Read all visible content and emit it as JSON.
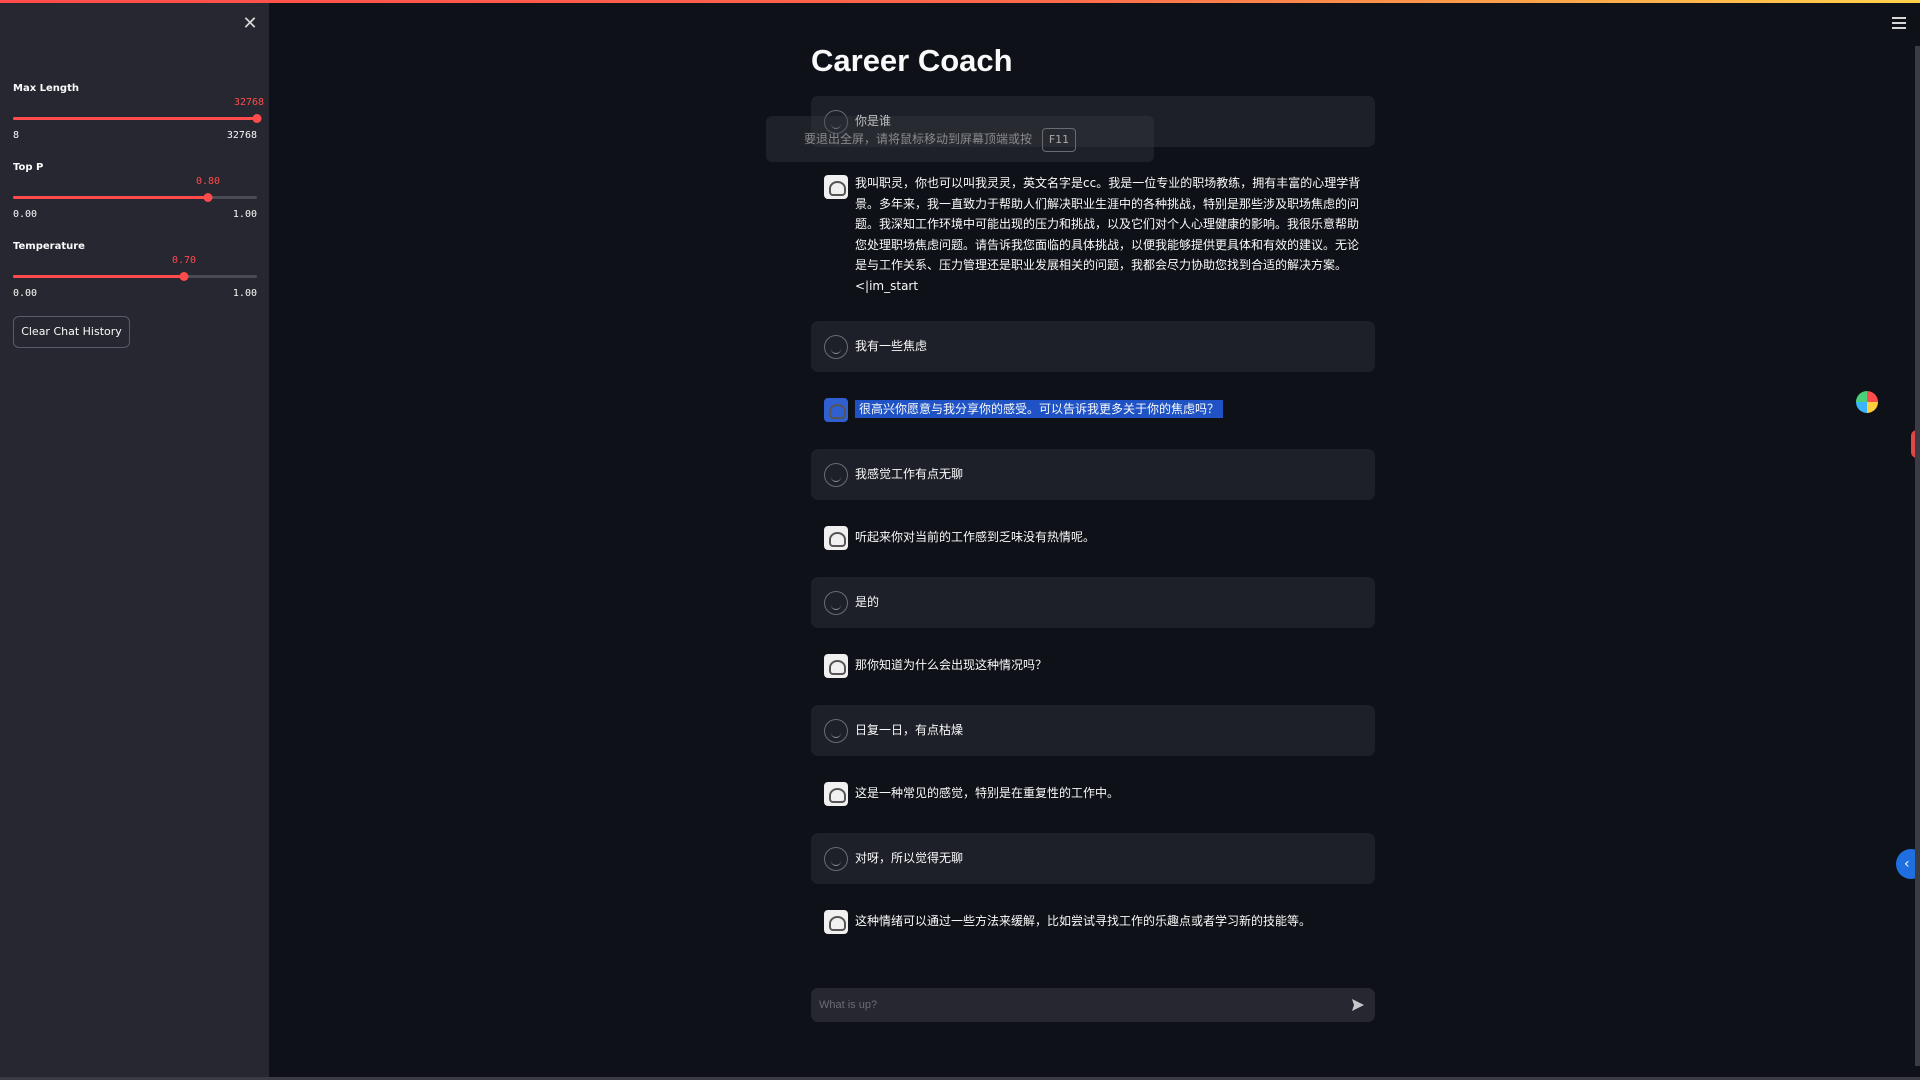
{
  "sidebar": {
    "close_label": "✕",
    "sliders": [
      {
        "label": "Max Length",
        "value": "32768",
        "min": "8",
        "max": "32768",
        "fraction": 1.0
      },
      {
        "label": "Top P",
        "value": "0.80",
        "min": "0.00",
        "max": "1.00",
        "fraction": 0.8
      },
      {
        "label": "Temperature",
        "value": "0.70",
        "min": "0.00",
        "max": "1.00",
        "fraction": 0.7
      }
    ],
    "clear_button": "Clear Chat History"
  },
  "main": {
    "title": "Career Coach",
    "fullscreen_hint": "要退出全屏，请将鼠标移动到屏幕顶端或按",
    "fullscreen_key": "F11",
    "messages": [
      {
        "role": "user",
        "text": "你是谁"
      },
      {
        "role": "assistant",
        "text": "我叫职灵，你也可以叫我灵灵，英文名字是cc。我是一位专业的职场教练，拥有丰富的心理学背景。多年来，我一直致力于帮助人们解决职业生涯中的各种挑战，特别是那些涉及职场焦虑的问题。我深知工作环境中可能出现的压力和挑战，以及它们对个人心理健康的影响。我很乐意帮助您处理职场焦虑问题。请告诉我您面临的具体挑战，以便我能够提供更具体和有效的建议。无论是与工作关系、压力管理还是职业发展相关的问题，我都会尽力协助您找到合适的解决方案。 <|im_start"
      },
      {
        "role": "user",
        "text": "我有一些焦虑"
      },
      {
        "role": "assistant",
        "text": "很高兴你愿意与我分享你的感受。可以告诉我更多关于你的焦虑吗？",
        "highlighted": true
      },
      {
        "role": "user",
        "text": "我感觉工作有点无聊"
      },
      {
        "role": "assistant",
        "text": "听起来你对当前的工作感到乏味没有热情呢。"
      },
      {
        "role": "user",
        "text": "是的"
      },
      {
        "role": "assistant",
        "text": "那你知道为什么会出现这种情况吗？"
      },
      {
        "role": "user",
        "text": "日复一日，有点枯燥"
      },
      {
        "role": "assistant",
        "text": "这是一种常见的感觉，特别是在重复性的工作中。"
      },
      {
        "role": "user",
        "text": "对呀，所以觉得无聊"
      },
      {
        "role": "assistant",
        "text": "这种情绪可以通过一些方法来缓解，比如尝试寻找工作的乐趣点或者学习新的技能等。"
      }
    ],
    "input_placeholder": "What is up?"
  },
  "colors": {
    "accent": "#ff4b4b",
    "background": "#0e1117",
    "sidebar": "#262730",
    "highlight": "#1f53c5"
  }
}
